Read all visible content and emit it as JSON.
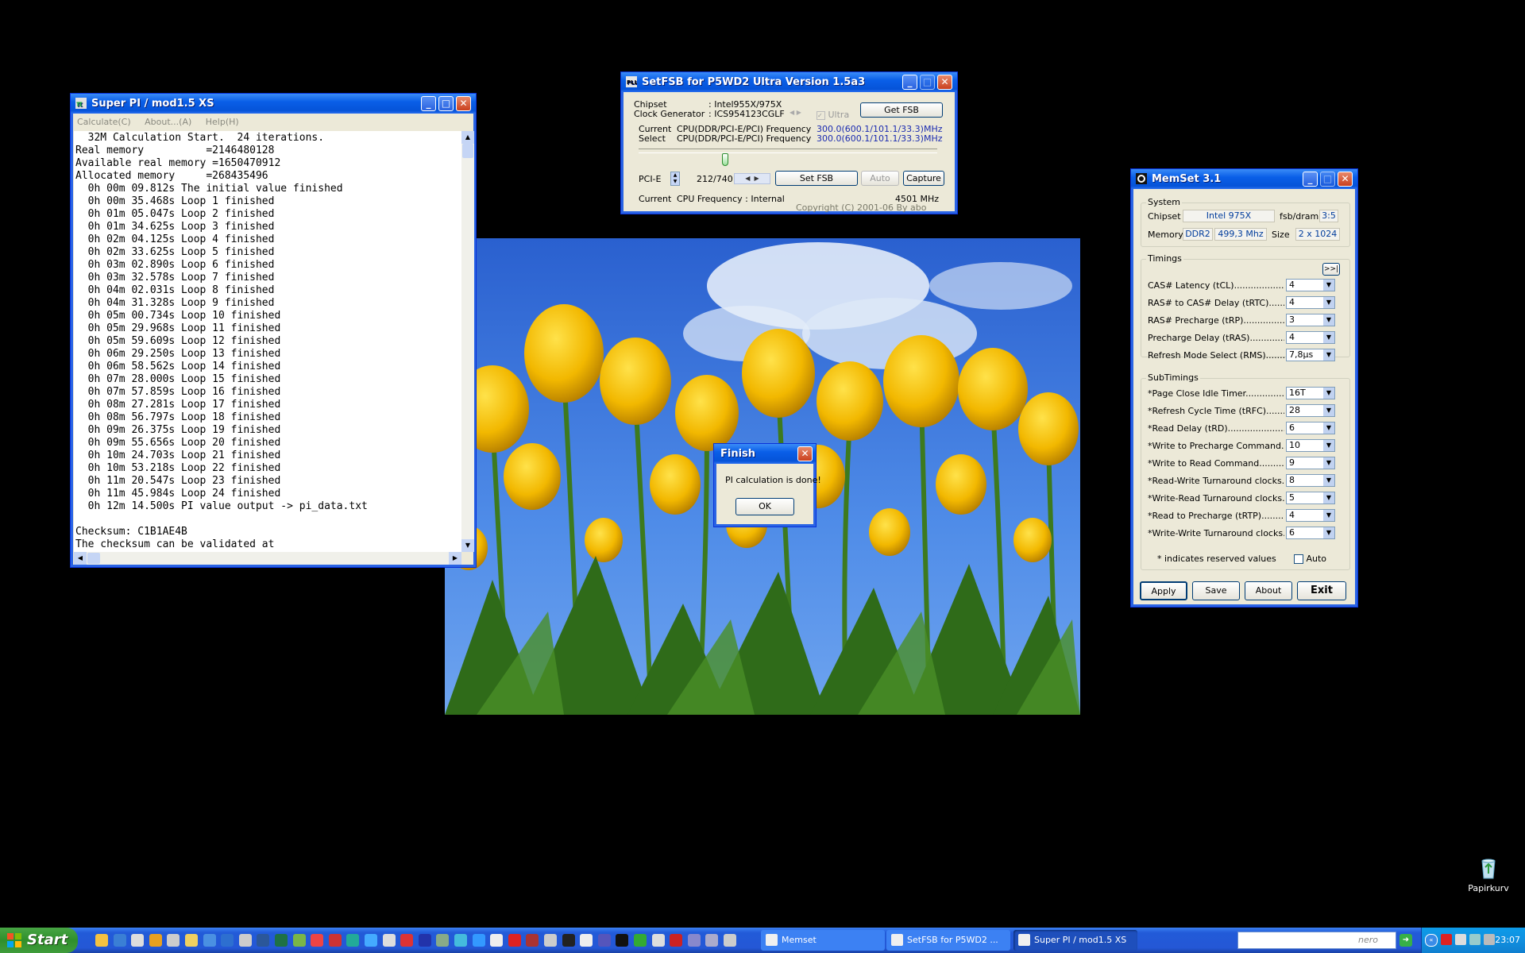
{
  "superpi": {
    "title": "Super PI / mod1.5 XS",
    "menu": [
      "Calculate(C)",
      "About...(A)",
      "Help(H)"
    ],
    "lines": [
      "  32M Calculation Start.  24 iterations.",
      "Real memory          =2146480128",
      "Available real memory =1650470912",
      "Allocated memory     =268435496",
      "  0h 00m 09.812s The initial value finished",
      "  0h 00m 35.468s Loop 1 finished",
      "  0h 01m 05.047s Loop 2 finished",
      "  0h 01m 34.625s Loop 3 finished",
      "  0h 02m 04.125s Loop 4 finished",
      "  0h 02m 33.625s Loop 5 finished",
      "  0h 03m 02.890s Loop 6 finished",
      "  0h 03m 32.578s Loop 7 finished",
      "  0h 04m 02.031s Loop 8 finished",
      "  0h 04m 31.328s Loop 9 finished",
      "  0h 05m 00.734s Loop 10 finished",
      "  0h 05m 29.968s Loop 11 finished",
      "  0h 05m 59.609s Loop 12 finished",
      "  0h 06m 29.250s Loop 13 finished",
      "  0h 06m 58.562s Loop 14 finished",
      "  0h 07m 28.000s Loop 15 finished",
      "  0h 07m 57.859s Loop 16 finished",
      "  0h 08m 27.281s Loop 17 finished",
      "  0h 08m 56.797s Loop 18 finished",
      "  0h 09m 26.375s Loop 19 finished",
      "  0h 09m 55.656s Loop 20 finished",
      "  0h 10m 24.703s Loop 21 finished",
      "  0h 10m 53.218s Loop 22 finished",
      "  0h 11m 20.547s Loop 23 finished",
      "  0h 11m 45.984s Loop 24 finished",
      "  0h 12m 14.500s PI value output -> pi_data.txt",
      "",
      "Checksum: C1B1AE4B",
      "The checksum can be validated at"
    ]
  },
  "setfsb": {
    "title": "SetFSB for P5WD2   Ultra Version 1.5a3",
    "chipset_label": "Chipset",
    "chipset_value": ": Intel955X/975X",
    "clockgen_label": "Clock Generator",
    "clockgen_value": ": ICS954123CGLF",
    "ultra_label": "Ultra",
    "get_fsb": "Get FSB",
    "current_label": "Current",
    "select_label": "Select",
    "freq_label": "CPU(DDR/PCI-E/PCI) Frequency",
    "current_freq": "300.0(600.1/101.1/33.3)MHz",
    "select_freq": "300.0(600.1/101.1/33.3)MHz",
    "pcie_label": "PCI-E",
    "counter": "212/740",
    "set_fsb": "Set FSB",
    "auto": "Auto",
    "capture": "Capture",
    "cpu_current_label": "Current",
    "cpu_freq_label": "CPU Frequency : Internal",
    "cpu_freq_value": "4501 MHz",
    "copyright": "Copyright (C) 2001-06 By abo",
    "slider_fraction": 0.29
  },
  "dialog": {
    "title": "Finish",
    "message": "PI calculation is done!",
    "ok": "OK"
  },
  "memset": {
    "title": "MemSet 3.1",
    "system_title": "System",
    "chipset_label": "Chipset",
    "chipset_value": "Intel 975X",
    "fsbdram_label": "fsb/dram",
    "fsbdram_value": "3:5",
    "memory_label": "Memory",
    "memory_type": "DDR2",
    "memory_freq": "499,3 Mhz",
    "size_label": "Size",
    "size_value": "2 x 1024",
    "timings_title": "Timings",
    "expand": ">>|",
    "timings": [
      {
        "label": "CAS# Latency (tCL)........................",
        "value": "4"
      },
      {
        "label": "RAS# to CAS# Delay (tRTC)..........",
        "value": "4"
      },
      {
        "label": "RAS# Precharge (tRP)....................",
        "value": "3"
      },
      {
        "label": "Precharge Delay  (tRAS)...............",
        "value": "4"
      },
      {
        "label": "Refresh Mode Select (RMS)...........",
        "value": "7,8µs"
      }
    ],
    "subtimings_title": "SubTimings",
    "subtimings": [
      {
        "label": "*Page Close Idle Timer.....................",
        "value": "16T"
      },
      {
        "label": "*Refresh Cycle Time (tRFC)...............",
        "value": "28"
      },
      {
        "label": "*Read Delay (tRD)...........................",
        "value": "6"
      },
      {
        "label": "*Write to Precharge Command.........",
        "value": "10"
      },
      {
        "label": "*Write to Read Command.................",
        "value": "9"
      },
      {
        "label": "*Read-Write Turnaround clocks.......",
        "value": "8"
      },
      {
        "label": "*Write-Read Turnaround clocks.......",
        "value": "5"
      },
      {
        "label": "*Read to Precharge (tRTP)...............",
        "value": "4"
      },
      {
        "label": "*Write-Write Turnaround clocks......",
        "value": "6"
      }
    ],
    "reserved_note": "* indicates reserved values",
    "auto_label": "Auto",
    "apply": "Apply",
    "save": "Save",
    "about": "About",
    "exit": "Exit"
  },
  "desktop": {
    "recycle_label": "Papirkurv"
  },
  "taskbar": {
    "start": "Start",
    "tasks": [
      {
        "label": "Memset",
        "active": false
      },
      {
        "label": "SetFSB for P5WD2   ...",
        "active": false
      },
      {
        "label": "Super PI / mod1.5 XS",
        "active": true
      }
    ],
    "search_brand": "nero",
    "clock": "23:07"
  },
  "colors": {
    "xp_blue": "#0553d8",
    "window_bg": "#ece9d8",
    "freq_blue": "#1b2bb0"
  }
}
